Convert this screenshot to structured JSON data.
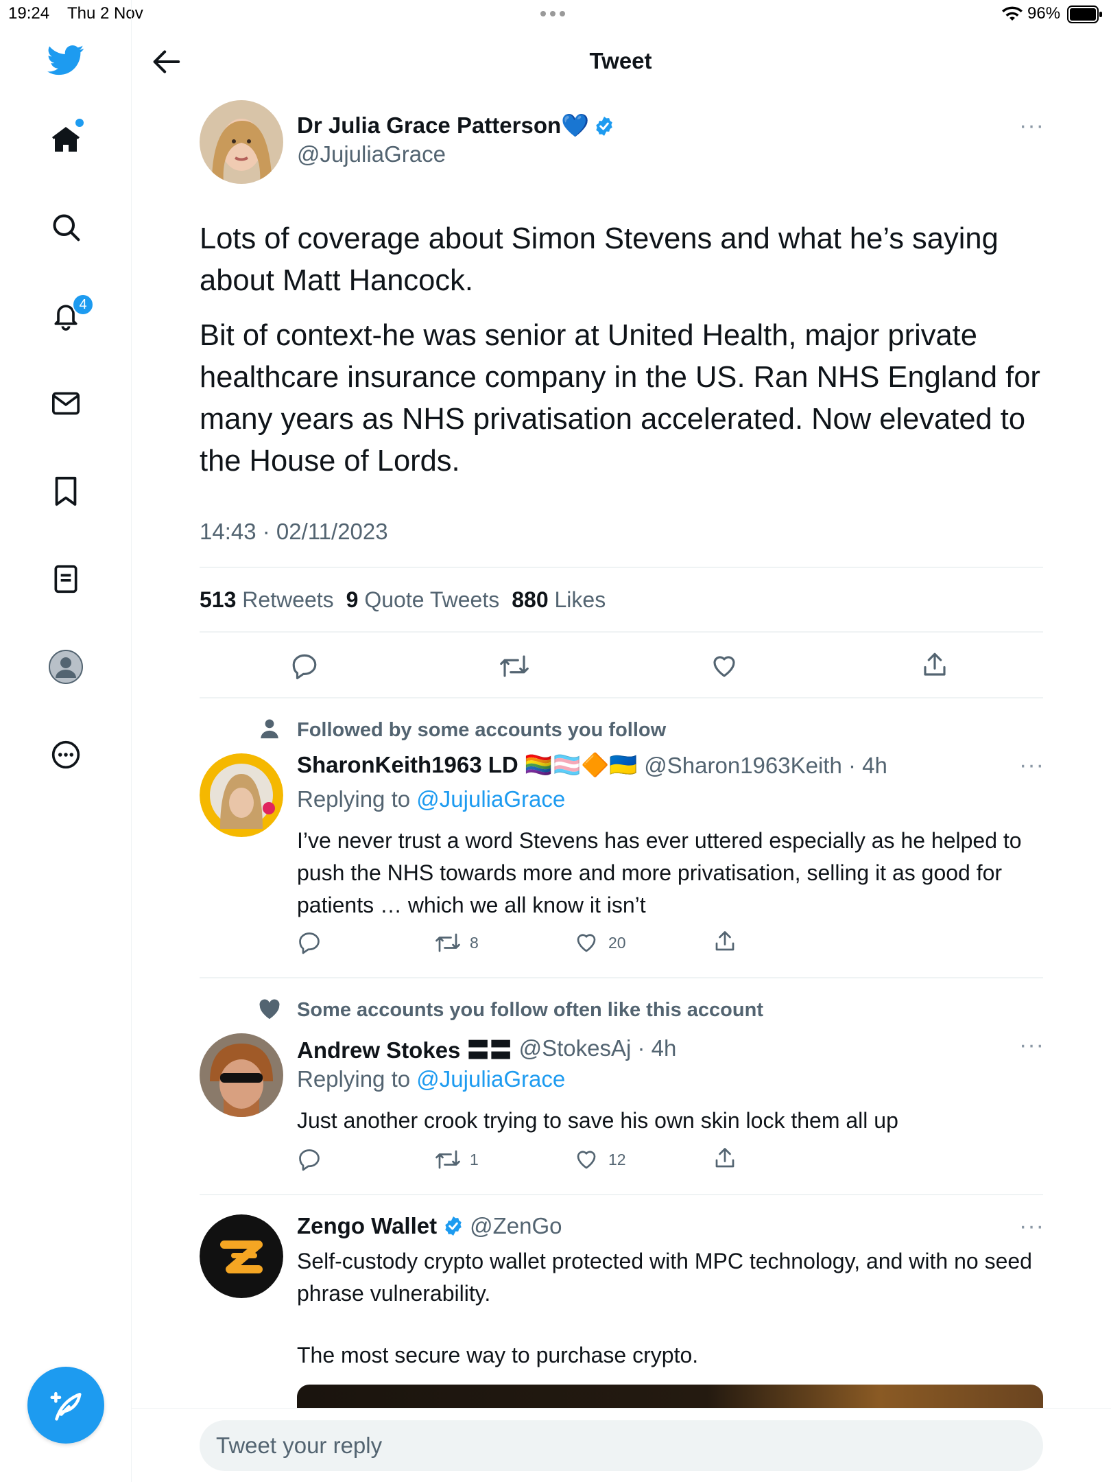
{
  "status": {
    "time": "19:24",
    "date": "Thu 2 Nov",
    "battery": "96%"
  },
  "header": {
    "title": "Tweet"
  },
  "sidebar": {
    "notifications_badge": "4"
  },
  "main_tweet": {
    "name": "Dr Julia Grace Patterson💙",
    "handle": "@JujuliaGrace",
    "paragraph1": "Lots of coverage about Simon Stevens and what he’s saying about Matt Hancock.",
    "paragraph2": "Bit of context-he was senior at United Health, major private healthcare insurance company in the US. Ran NHS England for many years as NHS privatisation accelerated. Now elevated to the House of Lords.",
    "timestamp": "14:43 · 02/11/2023",
    "retweets": "513",
    "retweets_label": "Retweets",
    "quotes": "9",
    "quotes_label": "Quote Tweets",
    "likes": "880",
    "likes_label": "Likes"
  },
  "replies": [
    {
      "context": "Followed by some accounts you follow",
      "name": "SharonKeith1963 LD 🏳️‍🌈🏳️‍⚧️🔶🇺🇦",
      "handle": "@Sharon1963Keith · 4h",
      "replying_prefix": "Replying to",
      "replying_to": "@JujuliaGrace",
      "text": "I’ve never trust a word Stevens has ever uttered especially as he helped to push the NHS towards more and more privatisation, selling it as good for patients … which we all know it isn’t",
      "retweets": "8",
      "likes": "20"
    },
    {
      "context": "Some accounts you follow often like this account",
      "name": "Andrew Stokes 〓〓",
      "handle": "@StokesAj · 4h",
      "replying_prefix": "Replying to",
      "replying_to": "@JujuliaGrace",
      "text": "Just another crook trying to save his own skin lock them all up",
      "retweets": "1",
      "likes": "12"
    }
  ],
  "promoted": {
    "name": "Zengo Wallet",
    "handle": "@ZenGo",
    "text1": "Self-custody crypto wallet protected with MPC technology, and with no seed phrase vulnerability.",
    "text2": "The most secure way to purchase crypto."
  },
  "compose": {
    "placeholder": "Tweet your reply"
  },
  "colors": {
    "accent": "#1d9bf0",
    "text": "#0f1419",
    "secondary": "#536471"
  }
}
